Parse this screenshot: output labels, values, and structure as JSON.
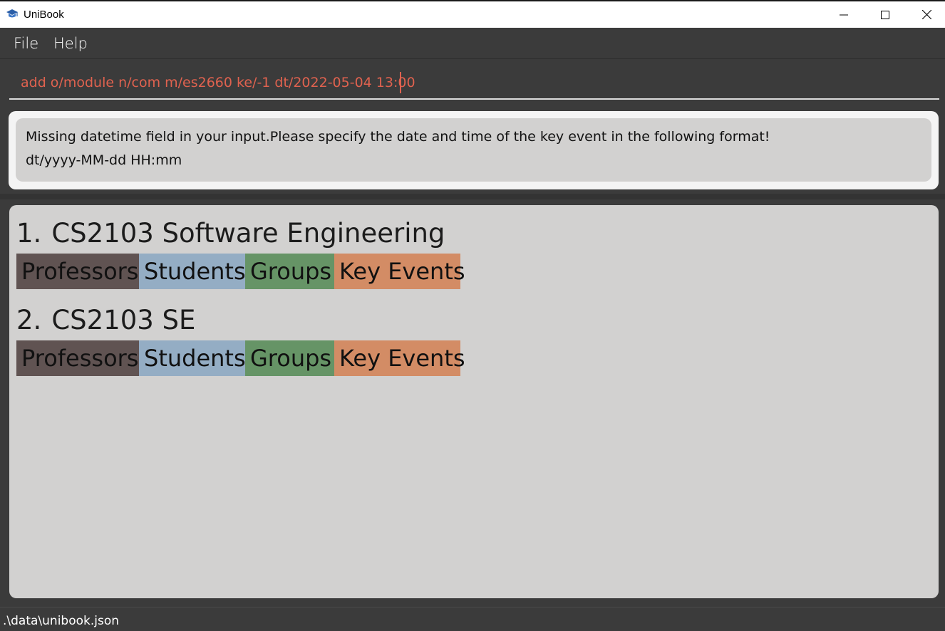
{
  "window": {
    "title": "UniBook",
    "icon": "graduation-cap-icon",
    "controls": [
      "minimize-icon",
      "maximize-icon",
      "close-icon"
    ]
  },
  "menu": {
    "file_label": "File",
    "help_label": "Help"
  },
  "command": {
    "value": "add o/module n/com m/es2660 ke/-1 dt/2022-05-04 13:00",
    "text_color": "#e0624f"
  },
  "result": {
    "line1": "Missing datetime field in your input.Please specify the date and time of the key event in the following format!",
    "line2": "dt/yyyy-MM-dd HH:mm"
  },
  "modules": [
    {
      "index": "1.",
      "title": "CS2103 Software Engineering",
      "tags": [
        "Professors",
        "Students",
        "Groups",
        "Key Events"
      ]
    },
    {
      "index": "2.",
      "title": "CS2103 SE",
      "tags": [
        "Professors",
        "Students",
        "Groups",
        "Key Events"
      ]
    }
  ],
  "tag_colors": {
    "professors": "#605352",
    "students": "#94adc4",
    "groups": "#669466",
    "key_events": "#d38c65"
  },
  "status": {
    "file_path": ".\\data\\unibook.json"
  }
}
